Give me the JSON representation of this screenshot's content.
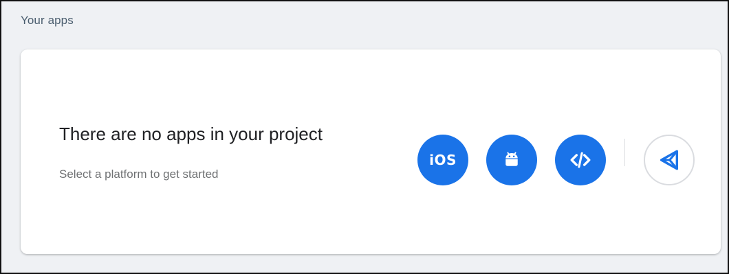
{
  "section": {
    "title": "Your apps"
  },
  "empty_state": {
    "title": "There are no apps in your project",
    "subtitle": "Select a platform to get started"
  },
  "platforms": [
    {
      "id": "ios",
      "label": "iOS",
      "icon": "ios-icon"
    },
    {
      "id": "android",
      "icon": "android-icon"
    },
    {
      "id": "web",
      "icon": "code-icon"
    },
    {
      "id": "unity",
      "icon": "unity-icon"
    }
  ],
  "colors": {
    "accent": "#1a73e8",
    "page_background": "#eff1f4",
    "card_background": "#ffffff",
    "unity_icon": "#1a73e8"
  }
}
